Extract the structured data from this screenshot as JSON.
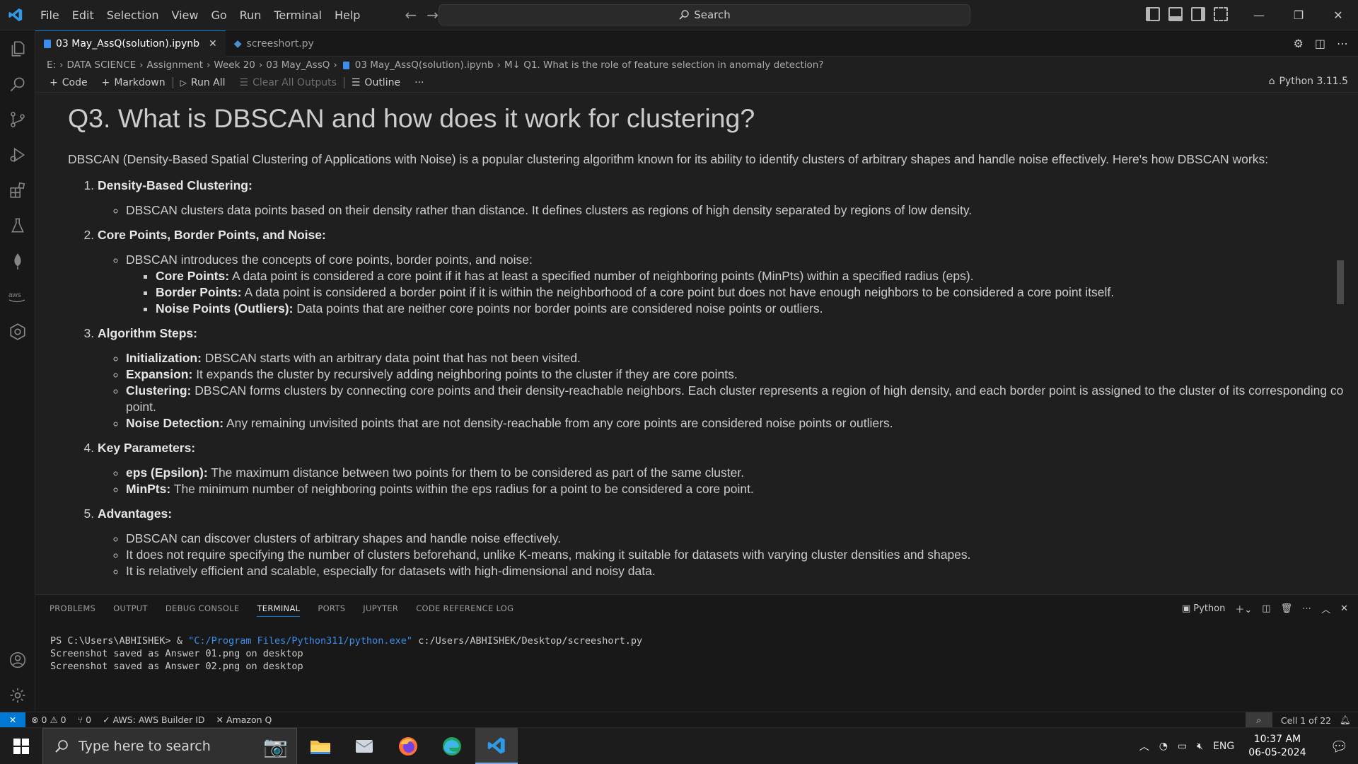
{
  "menu": [
    "File",
    "Edit",
    "Selection",
    "View",
    "Go",
    "Run",
    "Terminal",
    "Help"
  ],
  "search": {
    "label": "Search"
  },
  "tabs": [
    {
      "label": "03 May_AssQ(solution).ipynb",
      "active": true
    },
    {
      "label": "screeshort.py",
      "active": false
    }
  ],
  "breadcrumb": [
    "E:",
    "DATA SCIENCE",
    "Assignment",
    "Week 20",
    "03 May_AssQ",
    "03 May_AssQ(solution).ipynb",
    "M↓ Q1. What is the role of feature selection in anomaly detection?"
  ],
  "toolbar": {
    "code": "Code",
    "markdown": "Markdown",
    "run_all": "Run All",
    "clear": "Clear All Outputs",
    "outline": "Outline",
    "more": "···",
    "kernel": "Python 3.11.5"
  },
  "doc": {
    "title": "Q3. What is DBSCAN and how does it work for clustering?",
    "intro": "DBSCAN (Density-Based Spatial Clustering of Applications with Noise) is a popular clustering algorithm known for its ability to identify clusters of arbitrary shapes and handle noise effectively. Here's how DBSCAN works:",
    "s1": {
      "title": "Density-Based Clustering:",
      "b1": "DBSCAN clusters data points based on their density rather than distance. It defines clusters as regions of high density separated by regions of low density."
    },
    "s2": {
      "title": "Core Points, Border Points, and Noise:",
      "b1": "DBSCAN introduces the concepts of core points, border points, and noise:",
      "core_k": "Core Points:",
      "core_v": " A data point is considered a core point if it has at least a specified number of neighboring points (MinPts) within a specified radius (eps).",
      "border_k": "Border Points:",
      "border_v": " A data point is considered a border point if it is within the neighborhood of a core point but does not have enough neighbors to be considered a core point itself.",
      "noise_k": "Noise Points (Outliers):",
      "noise_v": " Data points that are neither core points nor border points are considered noise points or outliers."
    },
    "s3": {
      "title": "Algorithm Steps:",
      "init_k": "Initialization:",
      "init_v": " DBSCAN starts with an arbitrary data point that has not been visited.",
      "exp_k": "Expansion:",
      "exp_v": " It expands the cluster by recursively adding neighboring points to the cluster if they are core points.",
      "clu_k": "Clustering:",
      "clu_v": " DBSCAN forms clusters by connecting core points and their density-reachable neighbors. Each cluster represents a region of high density, and each border point is assigned to the cluster of its corresponding core point.",
      "nd_k": "Noise Detection:",
      "nd_v": " Any remaining unvisited points that are not density-reachable from any core points are considered noise points or outliers."
    },
    "s4": {
      "title": "Key Parameters:",
      "eps_k": "eps (Epsilon):",
      "eps_v": " The maximum distance between two points for them to be considered as part of the same cluster.",
      "min_k": "MinPts:",
      "min_v": " The minimum number of neighboring points within the eps radius for a point to be considered a core point."
    },
    "s5": {
      "title": "Advantages:",
      "a1": "DBSCAN can discover clusters of arbitrary shapes and handle noise effectively.",
      "a2": "It does not require specifying the number of clusters beforehand, unlike K-means, making it suitable for datasets with varying cluster densities and shapes.",
      "a3": "It is relatively efficient and scalable, especially for datasets with high-dimensional and noisy data."
    }
  },
  "panel": {
    "tabs": [
      "PROBLEMS",
      "OUTPUT",
      "DEBUG CONSOLE",
      "TERMINAL",
      "PORTS",
      "JUPYTER",
      "CODE REFERENCE LOG"
    ],
    "active_tab": "TERMINAL",
    "shell": "Python",
    "term_prompt": "PS C:\\Users\\ABHISHEK> & ",
    "term_exe": "\"C:/Program Files/Python311/python.exe\"",
    "term_arg": " c:/Users/ABHISHEK/Desktop/screeshort.py",
    "term_line2": "Screenshot saved as Answer 01.png on desktop",
    "term_line3": "Screenshot saved as Answer 02.png on desktop"
  },
  "status": {
    "errors": "0",
    "warnings": "0",
    "ports": "0",
    "aws": "AWS: AWS Builder ID",
    "amazonq": "Amazon Q",
    "cell": "Cell 1 of 22"
  },
  "taskbar": {
    "search_placeholder": "Type here to search",
    "lang": "ENG",
    "time": "10:37 AM",
    "date": "06-05-2024"
  },
  "colors": {
    "accent": "#0078d4",
    "bg": "#1f1f1f",
    "terminal_string": "#3b8eea"
  }
}
